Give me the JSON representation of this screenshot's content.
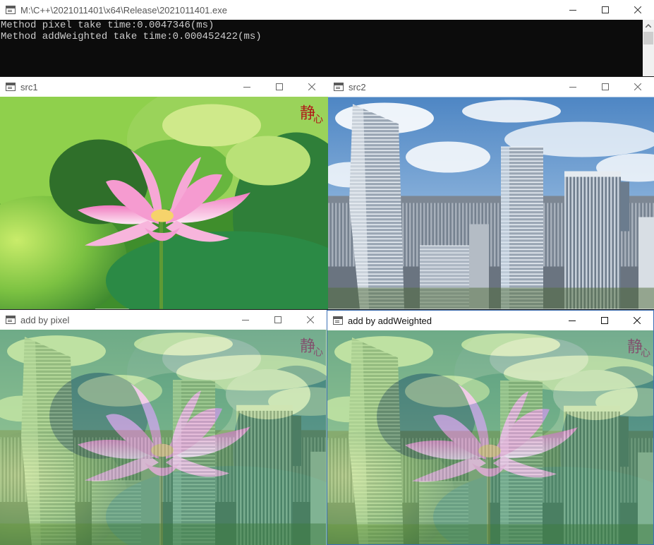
{
  "console": {
    "title": "M:\\C++\\2021011401\\x64\\Release\\2021011401.exe",
    "lines": [
      "Method pixel take time:0.0047346(ms)",
      "Method addWeighted take time:0.000452422(ms)"
    ]
  },
  "windows": {
    "src1": {
      "title": "src1"
    },
    "src2": {
      "title": "src2"
    },
    "add_pixel": {
      "title": "add by pixel"
    },
    "add_weighted": {
      "title": "add by addWeighted"
    }
  },
  "colors": {
    "console_bg": "#0c0c0c",
    "console_text": "#cccccc",
    "active_border": "#3b6fb6"
  }
}
